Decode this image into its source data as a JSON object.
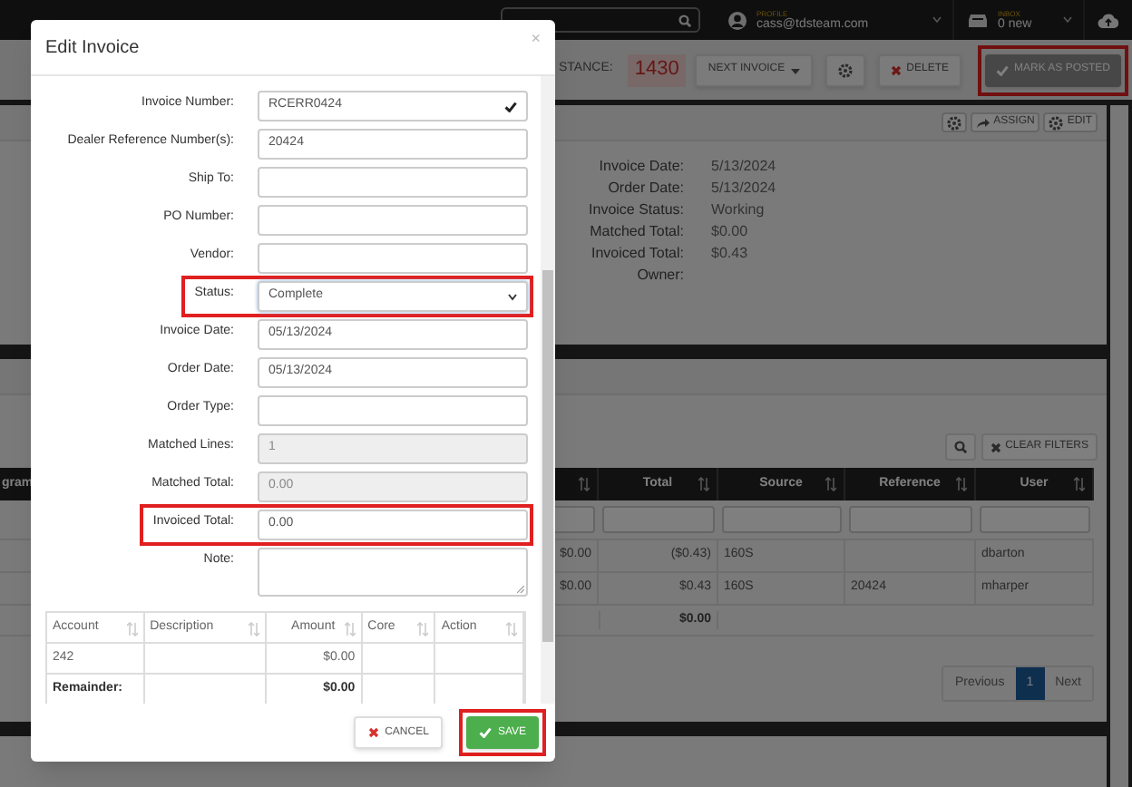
{
  "navbar": {
    "profile": {
      "label": "PROFILE",
      "email": "cass@tdsteam.com"
    },
    "inbox": {
      "label": "INBOX",
      "count": "0 new"
    }
  },
  "toolbar": {
    "distance_label": "STANCE:",
    "distance_value": "1430",
    "buttons": [
      {
        "kind": "dropdown",
        "label": "NEXT INVOICE",
        "disabled": false,
        "highlighted": false
      },
      {
        "kind": "gear",
        "disabled": false,
        "highlighted": false
      },
      {
        "kind": "delete",
        "label": "DELETE",
        "disabled": false,
        "highlighted": false
      },
      {
        "kind": "check",
        "label": "MARK AS POSTED",
        "disabled": true,
        "highlighted": true
      }
    ]
  },
  "details": {
    "actions": [
      {
        "kind": "gear"
      },
      {
        "kind": "assign",
        "label": "ASSIGN"
      },
      {
        "kind": "edit",
        "label": "EDIT"
      }
    ],
    "fields": [
      {
        "label": "Invoice Date:",
        "value": "5/13/2024"
      },
      {
        "label": "Order Date:",
        "value": "5/13/2024"
      },
      {
        "label": "Invoice Status:",
        "value": "Working"
      },
      {
        "label": "Matched Total:",
        "value": "$0.00"
      },
      {
        "label": "Invoiced Total:",
        "value": "$0.43"
      },
      {
        "label": "Owner:"
      }
    ]
  },
  "lines": {
    "actions": [
      {
        "kind": "search"
      },
      {
        "kind": "clear",
        "label": "CLEAR FILTERS"
      }
    ],
    "partial_column": "gram",
    "columns": [
      "Total",
      "Source",
      "Reference",
      "User"
    ],
    "rows": [
      {
        "column_1": "$0.00",
        "total": "($0.43)",
        "source": "160S",
        "user": "dbarton"
      },
      {
        "column_1": "$0.00",
        "total": "$0.43",
        "source": "160S",
        "reference": "20424",
        "user": "mharper"
      }
    ],
    "footer_total": "$0.00",
    "pagination": [
      {
        "label": "Previous",
        "selected": false
      },
      {
        "label": "1",
        "selected": true
      },
      {
        "label": "Next",
        "selected": false
      }
    ]
  },
  "modal": {
    "title": "Edit Invoice",
    "close": "×",
    "fields": [
      {
        "label": "Invoice Number:",
        "kind": "text",
        "value": "RCERR0424",
        "valid": true,
        "disabled": false,
        "highlighted": false
      },
      {
        "label": "Dealer Reference Number(s):",
        "kind": "text",
        "value": "20424",
        "valid": false,
        "disabled": false,
        "highlighted": false
      },
      {
        "label": "Ship To:",
        "kind": "text",
        "valid": false,
        "disabled": false,
        "highlighted": false
      },
      {
        "label": "PO Number:",
        "kind": "text",
        "valid": false,
        "disabled": false,
        "highlighted": false
      },
      {
        "label": "Vendor:",
        "kind": "text",
        "valid": false,
        "disabled": false,
        "highlighted": false
      },
      {
        "label": "Status:",
        "kind": "select",
        "value": "Complete",
        "valid": false,
        "disabled": false,
        "highlighted": true
      },
      {
        "label": "Invoice Date:",
        "kind": "text",
        "value": "05/13/2024",
        "valid": false,
        "disabled": false,
        "highlighted": false
      },
      {
        "label": "Order Date:",
        "kind": "text",
        "value": "05/13/2024",
        "valid": false,
        "disabled": false,
        "highlighted": false
      },
      {
        "label": "Order Type:",
        "kind": "text",
        "valid": false,
        "disabled": false,
        "highlighted": false
      },
      {
        "label": "Matched Lines:",
        "kind": "text",
        "value": "1",
        "valid": false,
        "disabled": true,
        "highlighted": false
      },
      {
        "label": "Matched Total:",
        "kind": "text",
        "value": "0.00",
        "valid": false,
        "disabled": true,
        "highlighted": false
      },
      {
        "label": "Invoiced Total:",
        "kind": "text",
        "value": "0.00",
        "valid": false,
        "disabled": false,
        "highlighted": true
      },
      {
        "label": "Note:",
        "kind": "textarea",
        "valid": false,
        "disabled": false,
        "highlighted": false
      }
    ],
    "table": {
      "columns": [
        "Account",
        "Description",
        "Amount",
        "Core",
        "Action"
      ],
      "rows": [
        {
          "account": "242",
          "amount": "$0.00",
          "bold": false
        },
        {
          "account": "Remainder:",
          "amount": "$0.00",
          "bold": true
        }
      ]
    },
    "buttons": [
      {
        "kind": "cancel",
        "label": "CANCEL",
        "highlighted": false
      },
      {
        "kind": "save",
        "label": "SAVE",
        "highlighted": true
      }
    ]
  }
}
